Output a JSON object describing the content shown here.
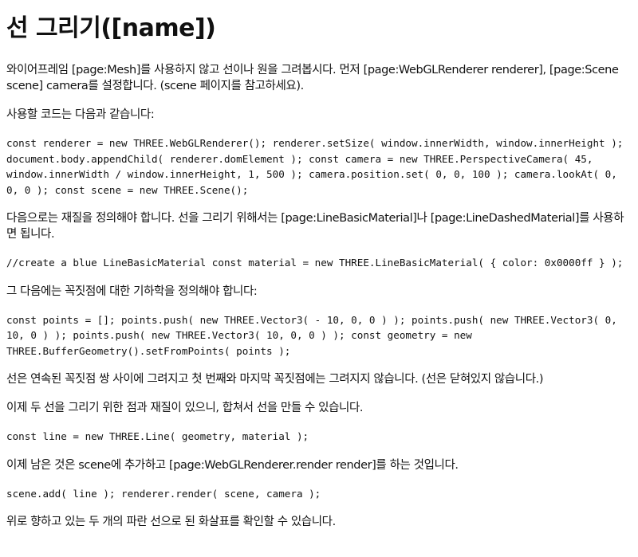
{
  "title": "선 그리기([name])",
  "blocks": {
    "p1": "와이어프레임 [page:Mesh]를 사용하지 않고 선이나 원을 그려봅시다. 먼저 [page:WebGLRenderer renderer], [page:Scene scene] camera를 설정합니다. (scene 페이지를 참고하세요).",
    "p2": "사용할 코드는 다음과 같습니다:",
    "c1": "const renderer = new THREE.WebGLRenderer(); renderer.setSize( window.innerWidth, window.innerHeight ); document.body.appendChild( renderer.domElement ); const camera = new THREE.PerspectiveCamera( 45, window.innerWidth / window.innerHeight, 1, 500 ); camera.position.set( 0, 0, 100 ); camera.lookAt( 0, 0, 0 ); const scene = new THREE.Scene();",
    "p3": "다음으로는 재질을 정의해야 합니다. 선을 그리기 위해서는 [page:LineBasicMaterial]나 [page:LineDashedMaterial]를 사용하면 됩니다.",
    "c2": "//create a blue LineBasicMaterial const material = new THREE.LineBasicMaterial( { color: 0x0000ff } );",
    "p4": "그 다음에는 꼭짓점에 대한 기하학을 정의해야 합니다:",
    "c3": "const points = []; points.push( new THREE.Vector3( - 10, 0, 0 ) ); points.push( new THREE.Vector3( 0, 10, 0 ) ); points.push( new THREE.Vector3( 10, 0, 0 ) ); const geometry = new THREE.BufferGeometry().setFromPoints( points );",
    "p5": "선은 연속된 꼭짓점 쌍 사이에 그려지고 첫 번째와 마지막 꼭짓점에는 그려지지 않습니다. (선은 닫혀있지 않습니다.)",
    "p6": "이제 두 선을 그리기 위한 점과 재질이 있으니, 합쳐서 선을 만들 수 있습니다.",
    "c4": "const line = new THREE.Line( geometry, material );",
    "p7": "이제 남은 것은 scene에 추가하고 [page:WebGLRenderer.render render]를 하는 것입니다.",
    "c5": "scene.add( line ); renderer.render( scene, camera );",
    "p8": "위로 향하고 있는 두 개의 파란 선으로 된 화살표를 확인할 수 있습니다."
  }
}
